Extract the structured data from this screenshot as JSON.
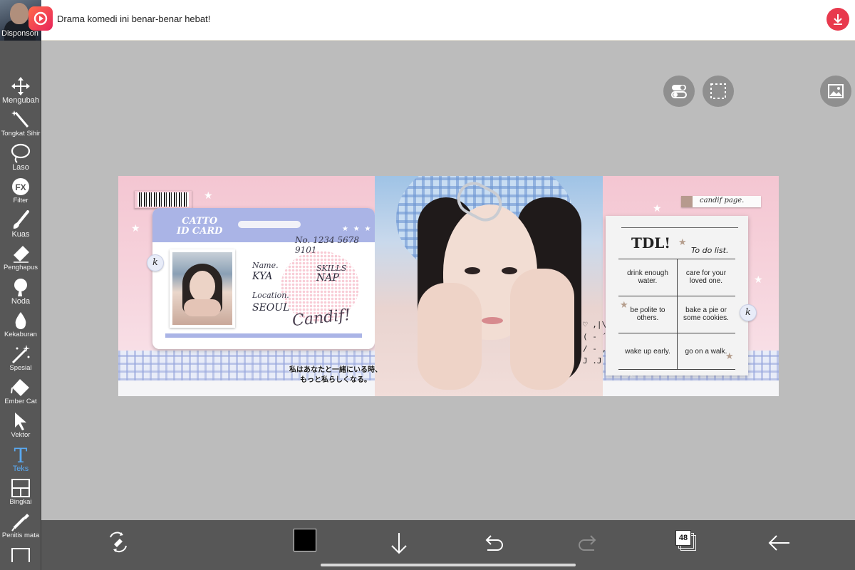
{
  "ad": {
    "sponsor_label": "Disponsori",
    "title": "Drama komedi ini benar-benar hebat!",
    "thumbnail_icon": "person-thumbnail",
    "logo_icon": "video-play-logo-icon",
    "download_icon": "download-icon",
    "accent_color": "#e8394d"
  },
  "toolbar": {
    "items": [
      {
        "label": "Mengubah",
        "icon": "move-arrows-icon"
      },
      {
        "label": "Tongkat Sihir",
        "icon": "magic-wand-icon"
      },
      {
        "label": "Laso",
        "icon": "lasso-icon"
      },
      {
        "label": "Filter",
        "icon": "fx-icon"
      },
      {
        "label": "Kuas",
        "icon": "brush-icon"
      },
      {
        "label": "Penghapus",
        "icon": "eraser-icon"
      },
      {
        "label": "Noda",
        "icon": "smudge-icon"
      },
      {
        "label": "Kekaburan",
        "icon": "blur-drop-icon"
      },
      {
        "label": "Spesial",
        "icon": "special-sparkle-icon"
      },
      {
        "label": "Ember Cat",
        "icon": "paint-bucket-icon"
      },
      {
        "label": "Vektor",
        "icon": "vector-cursor-icon"
      },
      {
        "label": "Teks",
        "icon": "text-icon",
        "active": true
      },
      {
        "label": "Bingkai",
        "icon": "frame-icon"
      },
      {
        "label": "Penitis mata",
        "icon": "eyedropper-icon"
      }
    ],
    "fx_glyph": "FX",
    "text_glyph": "T",
    "active_color": "#5aa9f0"
  },
  "canvas_buttons": {
    "toggle_icon": "toggle-icon",
    "selection_icon": "selection-icon",
    "image_icon": "image-icon"
  },
  "artwork": {
    "card": {
      "title_line1": "CATTO",
      "title_line2": "ID CARD",
      "stars": "★ ★ ★",
      "number": "No. 1234 5678 9101",
      "name_label": "Name.",
      "name_value": "KYA",
      "skills_label": "SKILLS",
      "skills_value": "NAP",
      "location_label": "Location.",
      "location_value": "SEOUL",
      "signature": "Candif!"
    },
    "k_badge": "k",
    "jp_line1": "私はあなたと一緒にいる時、",
    "jp_line2": "もっと私らしくなる。",
    "kaomoji": "♡ ,|\\\n( - ´)\n/ - ,|\nJ .J",
    "tag": "candif page.",
    "todo": {
      "heading": "TDL!",
      "subheading": "To do list.",
      "items": [
        "drink enough water.",
        "care for your loved one.",
        "be polite to others.",
        "bake a pie or some cookies.",
        "wake up early.",
        "go on a walk."
      ]
    }
  },
  "bottom_bar": {
    "transform_icon": "transform-icon",
    "color_value": "#000000",
    "download_icon": "arrow-down-icon",
    "undo_icon": "undo-icon",
    "redo_icon": "redo-icon",
    "layers_count": "48",
    "back_icon": "arrow-left-icon"
  }
}
